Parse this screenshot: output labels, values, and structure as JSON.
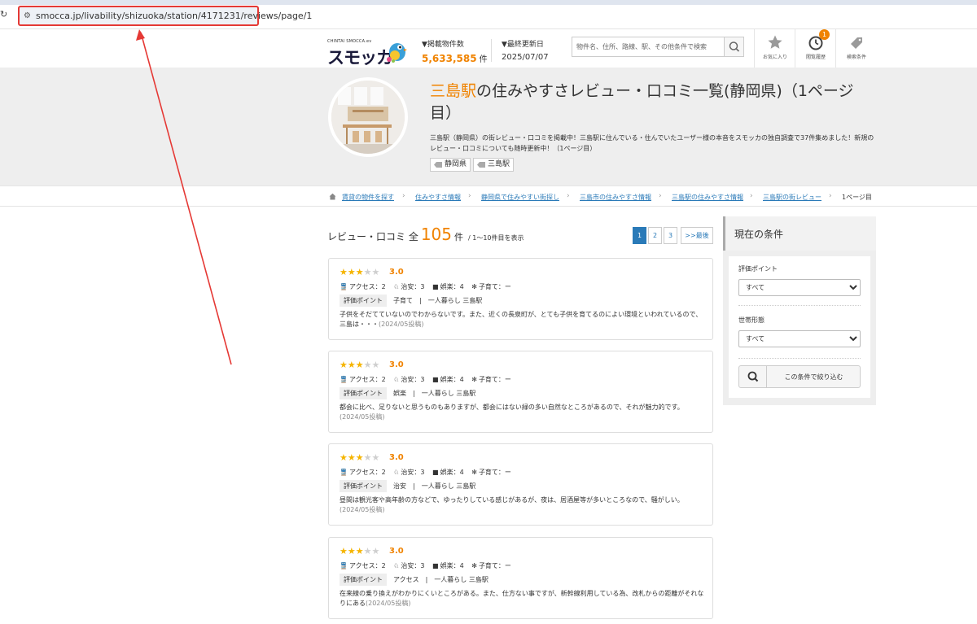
{
  "browser": {
    "url": "smocca.jp/livability/shizuoka/station/4171231/reviews/page/1"
  },
  "header": {
    "logo_small": "CHINTAI SMOCCA.ev",
    "logo_main": "スモッカ",
    "listings_label": "▼掲載物件数",
    "listings_value": "5,633,585",
    "listings_unit": "件",
    "updated_label": "▼最終更新日",
    "updated_value": "2025/07/07",
    "search_placeholder": "物件名、住所、路線、駅、その他条件で検索",
    "favorites_label": "お気に入り",
    "history_label": "閲覧履歴",
    "history_badge": "1",
    "conditions_label": "検索条件"
  },
  "hero": {
    "title_accent": "三島駅",
    "title_rest": "の住みやすさレビュー・口コミ一覧(静岡県)（1ページ目）",
    "description": "三島駅（静岡県）の街レビュー・口コミを掲載中！三島駅に住んでいる・住んでいたユーザー様の本音をスモッカの独自調査で37件集めました！新規のレビュー・口コミについても随時更新中！（1ページ目）",
    "tags": [
      "静岡県",
      "三島駅"
    ]
  },
  "breadcrumb": {
    "items": [
      "賃貸の物件を探す",
      "住みやすさ情報",
      "静岡県で住みやすい街探し",
      "三島市の住みやすさ情報",
      "三島駅の住みやすさ情報",
      "三島駅の街レビュー"
    ],
    "current": "1ページ目"
  },
  "reviews_header": {
    "label": "レビュー・口コミ 全",
    "count": "105",
    "unit": "件",
    "range": "/ 1〜10件目を表示"
  },
  "pager": [
    "1",
    "2",
    "3",
    ">>最後"
  ],
  "reviews": [
    {
      "rating": 3,
      "score": "3.0",
      "access": "アクセス：2",
      "safety": "治安：3",
      "fun": "娯楽：4",
      "child": "子育て：ー",
      "eval_label": "評価ポイント",
      "point": "子育て",
      "lifestyle": "一人暮らし 三島駅",
      "text": "子供をそだてていないのでわからないです。また、近くの長泉町が、とても子供を育てるのによい環境といわれているので、三島は・・・",
      "date": "(2024/05投稿)"
    },
    {
      "rating": 3,
      "score": "3.0",
      "access": "アクセス：2",
      "safety": "治安：3",
      "fun": "娯楽：4",
      "child": "子育て：ー",
      "eval_label": "評価ポイント",
      "point": "娯楽",
      "lifestyle": "一人暮らし 三島駅",
      "text": "都会に比べ、足りないと思うものもありますが、都会にはない緑の多い自然なところがあるので、それが魅力的です。",
      "date": "(2024/05投稿)"
    },
    {
      "rating": 3,
      "score": "3.0",
      "access": "アクセス：2",
      "safety": "治安：3",
      "fun": "娯楽：4",
      "child": "子育て：ー",
      "eval_label": "評価ポイント",
      "point": "治安",
      "lifestyle": "一人暮らし 三島駅",
      "text": "昼間は観光客や高年齢の方などで、ゆったりしている感じがあるが、夜は、居酒屋等が多いところなので、騒がしい。",
      "date": "(2024/05投稿)"
    },
    {
      "rating": 3,
      "score": "3.0",
      "access": "アクセス：2",
      "safety": "治安：3",
      "fun": "娯楽：4",
      "child": "子育て：ー",
      "eval_label": "評価ポイント",
      "point": "アクセス",
      "lifestyle": "一人暮らし 三島駅",
      "text": "在来線の乗り換えがわかりにくいところがある。また、仕方ない事ですが、新幹線利用している為、改札からの距離がそれなりにある",
      "date": "(2024/05投稿)"
    }
  ],
  "sidebar": {
    "title": "現在の条件",
    "eval_label": "評価ポイント",
    "eval_value": "すべて",
    "household_label": "世帯形態",
    "household_value": "すべて",
    "button_label": "この条件で絞り込む"
  },
  "colors": {
    "accent": "#f08300",
    "link": "#2a7ab8",
    "annotation": "#e53935"
  }
}
